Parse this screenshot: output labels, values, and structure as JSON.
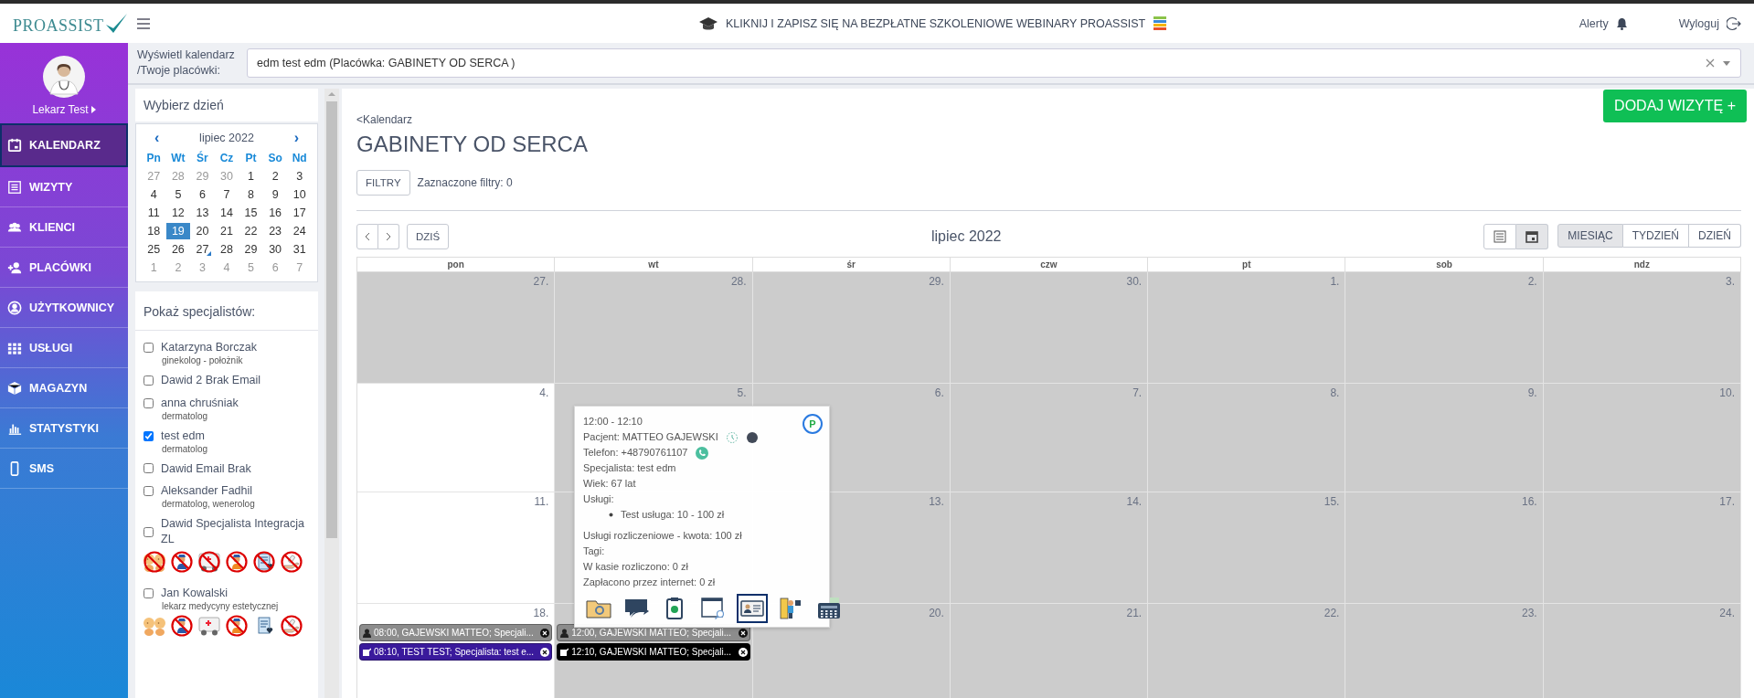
{
  "header": {
    "logo": "PROASSIST",
    "banner": "KLIKNIJ I ZAPISZ SIĘ NA BEZPŁATNE SZKOLENIOWE WEBINARY PROASSIST",
    "alerts": "Alerty",
    "logout": "Wyloguj"
  },
  "user": {
    "name": "Lekarz Test"
  },
  "nav": [
    {
      "label": "KALENDARZ",
      "kind": "calendar",
      "selected": true
    },
    {
      "label": "WIZYTY",
      "kind": "list",
      "selected": false
    },
    {
      "label": "KLIENCI",
      "kind": "group",
      "selected": false
    },
    {
      "label": "PLACÓWKI",
      "kind": "person-add",
      "selected": false
    },
    {
      "label": "UŻYTKOWNICY",
      "kind": "user-circle",
      "selected": false
    },
    {
      "label": "USŁUGI",
      "kind": "grid",
      "selected": false
    },
    {
      "label": "MAGAZYN",
      "kind": "cube",
      "selected": false
    },
    {
      "label": "STATYSTYKI",
      "kind": "chart",
      "selected": false
    },
    {
      "label": "SMS",
      "kind": "phone",
      "selected": false
    }
  ],
  "calendar_select": {
    "label_lines": [
      "Wyświetl kalendarz",
      "/Twoje placówki:"
    ],
    "value": "edm test edm (Placówka: GABINETY OD SERCA )"
  },
  "day_picker": {
    "title": "Wybierz dzień",
    "month": "lipiec 2022",
    "prev": "‹",
    "next": "›",
    "weekdays": [
      "Pn",
      "Wt",
      "Śr",
      "Cz",
      "Pt",
      "So",
      "Nd"
    ],
    "weeks": [
      [
        {
          "n": "27",
          "other_month": true,
          "selected": false,
          "marked": false
        },
        {
          "n": "28",
          "other_month": true,
          "selected": false,
          "marked": false
        },
        {
          "n": "29",
          "other_month": true,
          "selected": false,
          "marked": false
        },
        {
          "n": "30",
          "other_month": true,
          "selected": false,
          "marked": false
        },
        {
          "n": "1",
          "other_month": false,
          "selected": false,
          "marked": false
        },
        {
          "n": "2",
          "other_month": false,
          "selected": false,
          "marked": false
        },
        {
          "n": "3",
          "other_month": false,
          "selected": false,
          "marked": false
        }
      ],
      [
        {
          "n": "4",
          "other_month": false,
          "selected": false,
          "marked": false
        },
        {
          "n": "5",
          "other_month": false,
          "selected": false,
          "marked": false
        },
        {
          "n": "6",
          "other_month": false,
          "selected": false,
          "marked": false
        },
        {
          "n": "7",
          "other_month": false,
          "selected": false,
          "marked": false
        },
        {
          "n": "8",
          "other_month": false,
          "selected": false,
          "marked": false
        },
        {
          "n": "9",
          "other_month": false,
          "selected": false,
          "marked": false
        },
        {
          "n": "10",
          "other_month": false,
          "selected": false,
          "marked": false
        }
      ],
      [
        {
          "n": "11",
          "other_month": false,
          "selected": false,
          "marked": false
        },
        {
          "n": "12",
          "other_month": false,
          "selected": false,
          "marked": false
        },
        {
          "n": "13",
          "other_month": false,
          "selected": false,
          "marked": false
        },
        {
          "n": "14",
          "other_month": false,
          "selected": false,
          "marked": false
        },
        {
          "n": "15",
          "other_month": false,
          "selected": false,
          "marked": false
        },
        {
          "n": "16",
          "other_month": false,
          "selected": false,
          "marked": false
        },
        {
          "n": "17",
          "other_month": false,
          "selected": false,
          "marked": false
        }
      ],
      [
        {
          "n": "18",
          "other_month": false,
          "selected": false,
          "marked": false
        },
        {
          "n": "19",
          "other_month": false,
          "selected": true,
          "marked": false
        },
        {
          "n": "20",
          "other_month": false,
          "selected": false,
          "marked": false
        },
        {
          "n": "21",
          "other_month": false,
          "selected": false,
          "marked": false
        },
        {
          "n": "22",
          "other_month": false,
          "selected": false,
          "marked": false
        },
        {
          "n": "23",
          "other_month": false,
          "selected": false,
          "marked": false
        },
        {
          "n": "24",
          "other_month": false,
          "selected": false,
          "marked": false
        }
      ],
      [
        {
          "n": "25",
          "other_month": false,
          "selected": false,
          "marked": false
        },
        {
          "n": "26",
          "other_month": false,
          "selected": false,
          "marked": false
        },
        {
          "n": "27",
          "other_month": false,
          "selected": false,
          "marked": true
        },
        {
          "n": "28",
          "other_month": false,
          "selected": false,
          "marked": false
        },
        {
          "n": "29",
          "other_month": false,
          "selected": false,
          "marked": false
        },
        {
          "n": "30",
          "other_month": false,
          "selected": false,
          "marked": false
        },
        {
          "n": "31",
          "other_month": false,
          "selected": false,
          "marked": false
        }
      ],
      [
        {
          "n": "1",
          "other_month": true,
          "selected": false,
          "marked": false
        },
        {
          "n": "2",
          "other_month": true,
          "selected": false,
          "marked": false
        },
        {
          "n": "3",
          "other_month": true,
          "selected": false,
          "marked": false
        },
        {
          "n": "4",
          "other_month": true,
          "selected": false,
          "marked": false
        },
        {
          "n": "5",
          "other_month": true,
          "selected": false,
          "marked": false
        },
        {
          "n": "6",
          "other_month": true,
          "selected": false,
          "marked": false
        },
        {
          "n": "7",
          "other_month": true,
          "selected": false,
          "marked": false
        }
      ]
    ]
  },
  "specialists": {
    "title": "Pokaż specjalistów:",
    "items": [
      {
        "name": "Katarzyna Borczak",
        "role": "ginekolog - położnik",
        "checked": false
      },
      {
        "name": "Dawid 2 Brak Email",
        "checked": false
      },
      {
        "name": "anna chruśniak",
        "role": "dermatolog",
        "checked": false
      },
      {
        "name": "test edm",
        "role": "dermatolog",
        "checked": true
      },
      {
        "name": "Dawid Email Brak",
        "checked": false
      },
      {
        "name": "Aleksander Fadhil",
        "role": "dermatolog, wenerolog",
        "checked": false
      },
      {
        "name": "Dawid Specjalista Integracja ZL",
        "checked": false,
        "icons": [
          {
            "kind": "babies",
            "crossed": true
          },
          {
            "kind": "worker",
            "crossed": true
          },
          {
            "kind": "ambulance",
            "crossed": true
          },
          {
            "kind": "mechanic",
            "crossed": true
          },
          {
            "kind": "document",
            "crossed": true
          },
          {
            "kind": "hand",
            "crossed": true
          }
        ]
      },
      {
        "name": "Jan Kowalski",
        "role": "lekarz medycyny estetycznej",
        "checked": false,
        "icons": [
          {
            "kind": "babies",
            "crossed": false
          },
          {
            "kind": "worker",
            "crossed": true
          },
          {
            "kind": "ambulance",
            "crossed": false
          },
          {
            "kind": "mechanic",
            "crossed": true
          },
          {
            "kind": "document",
            "crossed": false
          },
          {
            "kind": "hand",
            "crossed": true
          }
        ]
      }
    ]
  },
  "page": {
    "back": "<Kalendarz",
    "title": "GABINETY OD SERCA",
    "filters_button": "FILTRY",
    "filters_count": "Zaznaczone filtry: 0",
    "add_button": "DODAJ WIZYTĘ +"
  },
  "toolbar": {
    "today": "DZIŚ",
    "month": "lipiec 2022",
    "layouts": [
      {
        "kind": "list",
        "selected": false
      },
      {
        "kind": "calendar",
        "selected": true
      }
    ],
    "views": [
      {
        "label": "MIESIĄC",
        "selected": true
      },
      {
        "label": "TYDZIEŃ",
        "selected": false
      },
      {
        "label": "DZIEŃ",
        "selected": false
      }
    ]
  },
  "month_grid": {
    "weekdays": [
      "pon",
      "wt",
      "śr",
      "czw",
      "pt",
      "sob",
      "ndz"
    ],
    "weeks": [
      [
        {
          "day": "27.",
          "closed": true
        },
        {
          "day": "28.",
          "closed": true
        },
        {
          "day": "29.",
          "closed": true
        },
        {
          "day": "30.",
          "closed": true
        },
        {
          "day": "1.",
          "closed": true
        },
        {
          "day": "2.",
          "closed": true
        },
        {
          "day": "3.",
          "closed": true
        }
      ],
      [
        {
          "day": "4.",
          "closed": false
        },
        {
          "day": "5.",
          "closed": true
        },
        {
          "day": "6.",
          "closed": true
        },
        {
          "day": "7.",
          "closed": true
        },
        {
          "day": "8.",
          "closed": true
        },
        {
          "day": "9.",
          "closed": true
        },
        {
          "day": "10.",
          "closed": true
        }
      ],
      [
        {
          "day": "11.",
          "closed": false
        },
        {
          "closed": true
        },
        {
          "day": "13.",
          "closed": true
        },
        {
          "day": "14.",
          "closed": true
        },
        {
          "day": "15.",
          "closed": true
        },
        {
          "day": "16.",
          "closed": true
        },
        {
          "day": "17.",
          "closed": true
        }
      ],
      [
        {
          "day": "18.",
          "closed": false,
          "events": [
            {
              "kind": "person",
              "color": "#8c8c8c",
              "text": "08:00, GAJEWSKI MATTEO; Specjali..."
            },
            {
              "kind": "note",
              "color": "#3a1a9c",
              "text": "08:10, TEST TEST; Specjalista: test e..."
            }
          ]
        },
        {
          "closed": true,
          "events": [
            {
              "kind": "person",
              "color": "#8c8c8c",
              "text": "12:00, GAJEWSKI MATTEO; Specjali..."
            },
            {
              "kind": "note",
              "color": "#000000",
              "text": "12:10, GAJEWSKI MATTEO; Specjali..."
            }
          ]
        },
        {
          "day": "20.",
          "closed": true
        },
        {
          "day": "21.",
          "closed": true
        },
        {
          "day": "22.",
          "closed": true
        },
        {
          "day": "23.",
          "closed": true
        },
        {
          "day": "24.",
          "closed": true
        }
      ]
    ]
  },
  "popup": {
    "badge": "P",
    "lines": [
      {
        "kind": "text",
        "text": "12:00 - 12:10"
      },
      {
        "kind": "patient",
        "text": "Pacjent: MATTEO GAJEWSKI"
      },
      {
        "kind": "phone",
        "text": "Telefon: +48790761107"
      },
      {
        "kind": "text",
        "text": "Specjalista: test edm"
      },
      {
        "kind": "text",
        "text": "Wiek: 67 lat"
      },
      {
        "kind": "text",
        "text": "Usługi:"
      },
      {
        "kind": "bullet",
        "text": "Test usługa: 10 - 100 zł"
      },
      {
        "kind": "gap",
        "text": "Usługi rozliczeniowe - kwota: 100 zł"
      },
      {
        "kind": "text",
        "text": "Tagi:"
      },
      {
        "kind": "text",
        "text": "W kasie rozliczono: 0 zł"
      },
      {
        "kind": "text",
        "text": "Zapłacono przez internet: 0 zł"
      }
    ],
    "actions": [
      {
        "kind": "folder",
        "selected": false
      },
      {
        "kind": "chat",
        "selected": false
      },
      {
        "kind": "clipboard",
        "selected": false
      },
      {
        "kind": "window-search",
        "selected": false
      },
      {
        "kind": "id-card",
        "selected": true
      },
      {
        "kind": "door",
        "selected": false
      },
      {
        "kind": "register",
        "selected": false
      }
    ]
  }
}
